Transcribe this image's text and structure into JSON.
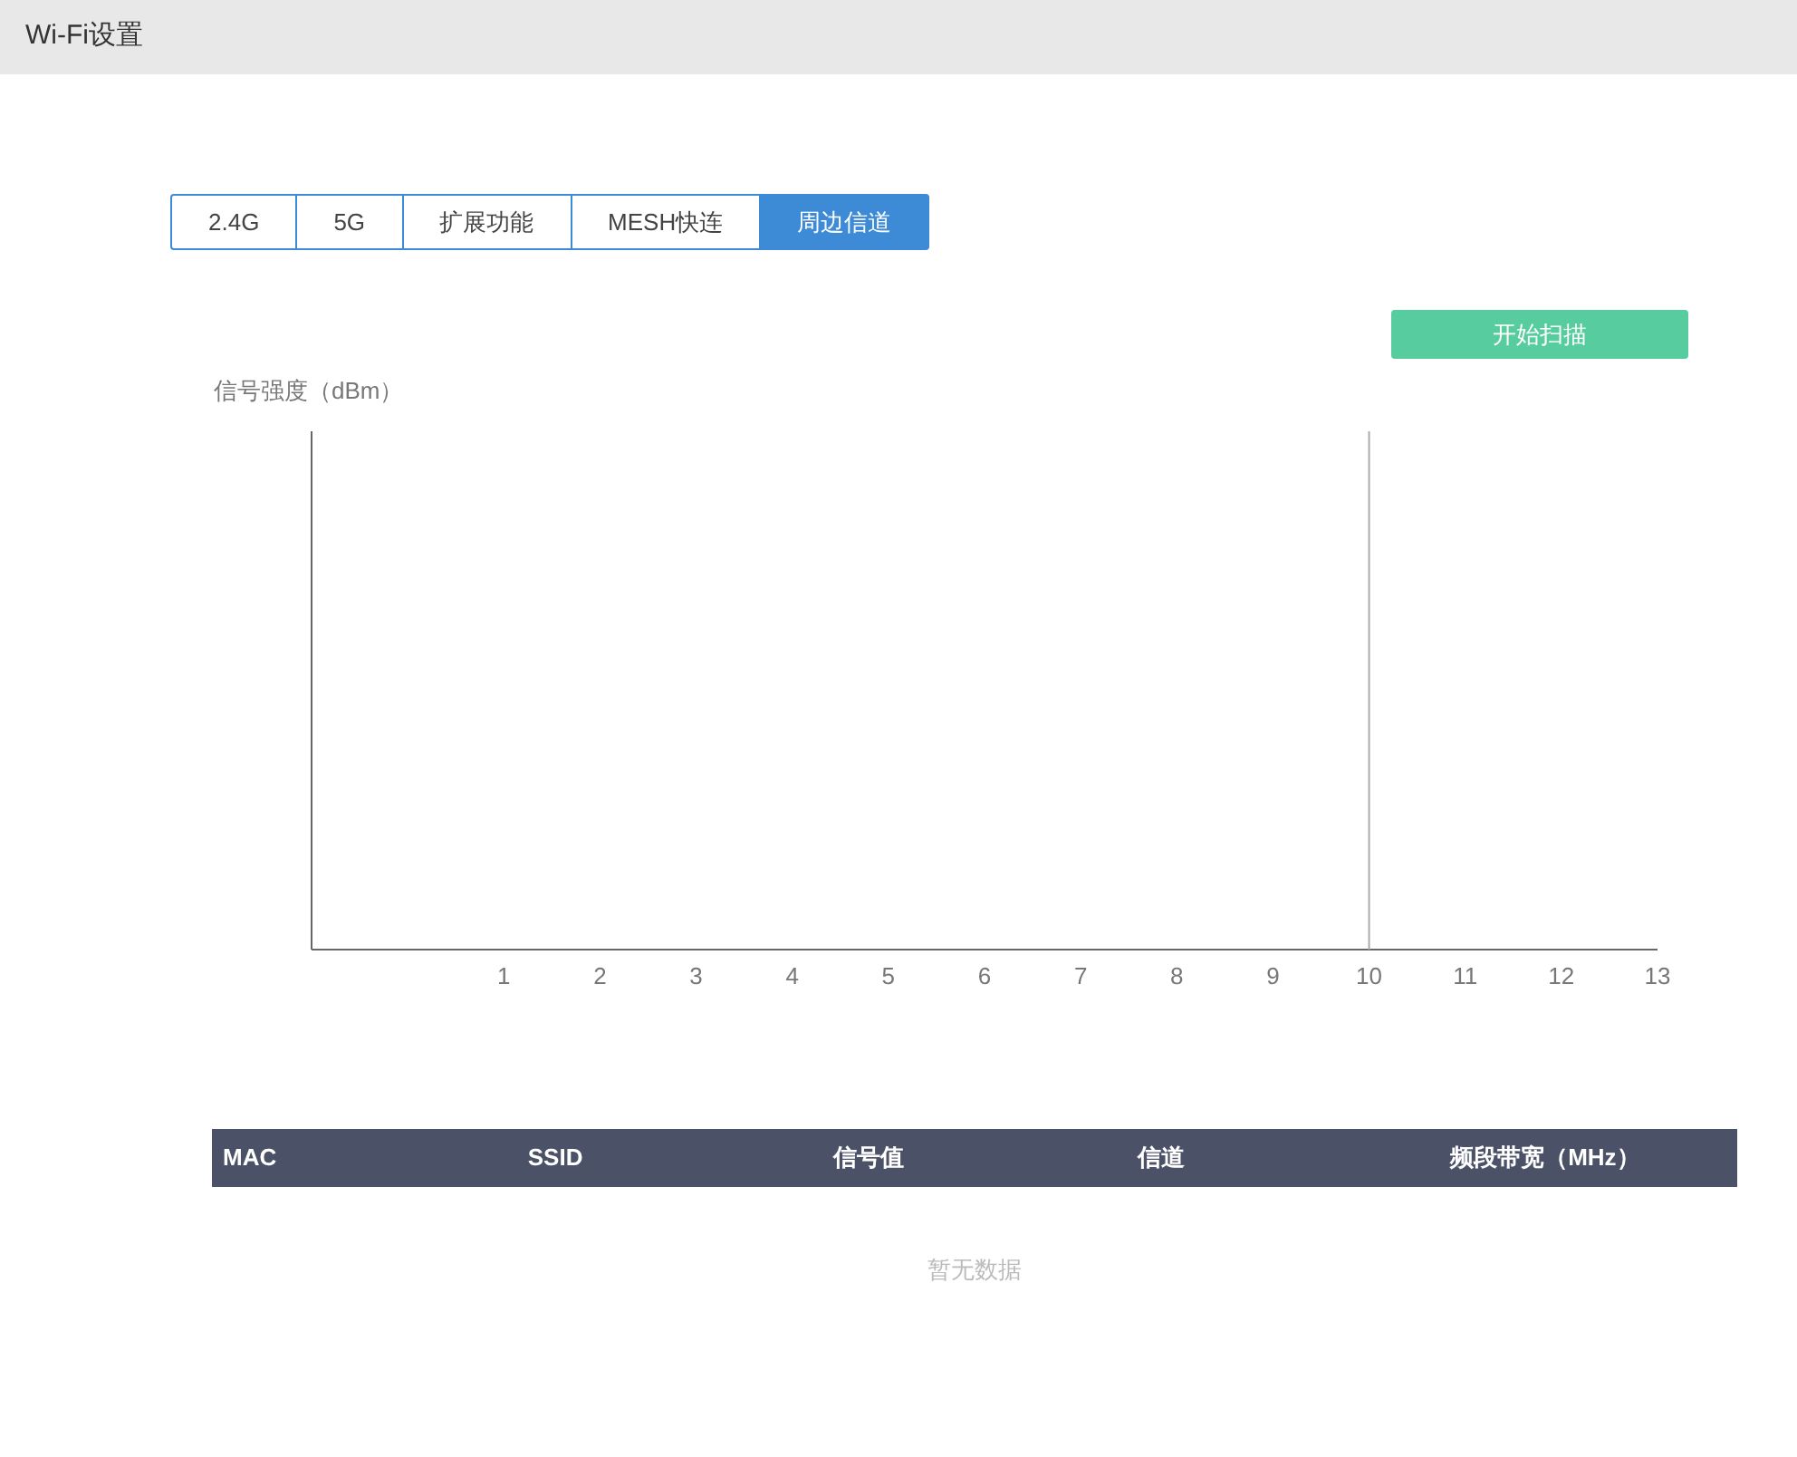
{
  "header": {
    "title": "Wi-Fi设置"
  },
  "tabs": [
    {
      "label": "2.4G",
      "selected": false
    },
    {
      "label": "5G",
      "selected": false
    },
    {
      "label": "扩展功能",
      "selected": false
    },
    {
      "label": "MESH快连",
      "selected": false
    },
    {
      "label": "周边信道",
      "selected": true
    }
  ],
  "scan_button": "开始扫描",
  "chart": {
    "y_label": "信号强度（dBm）",
    "channels": [
      {
        "label": "1",
        "marked": false
      },
      {
        "label": "2",
        "marked": false
      },
      {
        "label": "3",
        "marked": false
      },
      {
        "label": "4",
        "marked": false
      },
      {
        "label": "5",
        "marked": false
      },
      {
        "label": "6",
        "marked": false
      },
      {
        "label": "7",
        "marked": false
      },
      {
        "label": "8",
        "marked": false
      },
      {
        "label": "9",
        "marked": false
      },
      {
        "label": "10",
        "marked": true
      },
      {
        "label": "11",
        "marked": false
      },
      {
        "label": "12",
        "marked": false
      },
      {
        "label": "13",
        "marked": false
      }
    ]
  },
  "table": {
    "columns": [
      "MAC",
      "SSID",
      "信号值",
      "信道",
      "频段带宽（MHz）"
    ],
    "empty_text": "暂无数据"
  }
}
